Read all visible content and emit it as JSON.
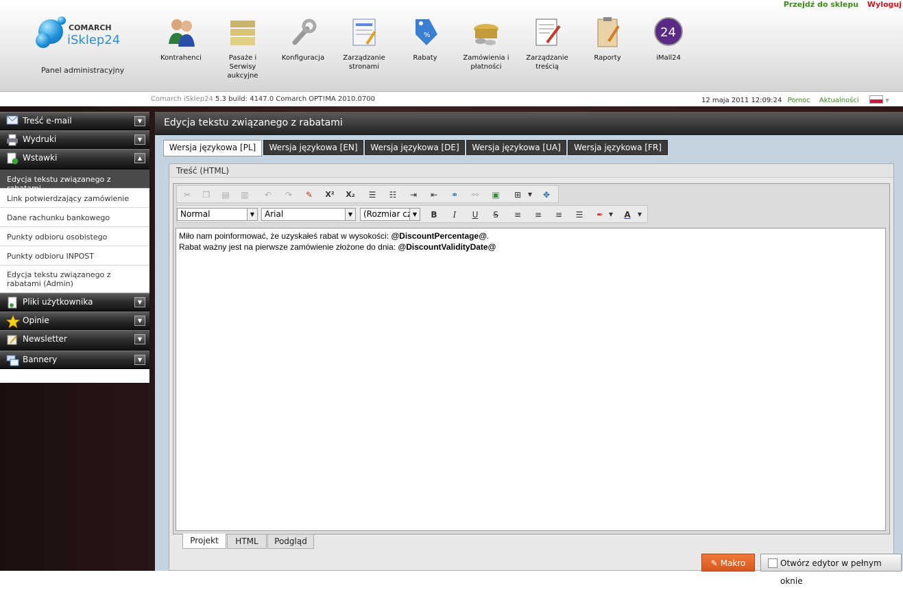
{
  "top_links": {
    "shop": "Przejdź do sklepu",
    "logout": "Wyloguj"
  },
  "logo": {
    "brand1": "COMARCH",
    "brand2": "iSklep24",
    "subtitle": "Panel administracyjny"
  },
  "nav": [
    {
      "label": "Kontrahenci",
      "icon": "users-icon"
    },
    {
      "label": "Pasaże i Serwisy aukcyjne",
      "icon": "folders-icon"
    },
    {
      "label": "Konfiguracja",
      "icon": "wrench-icon"
    },
    {
      "label": "Zarządzanie stronami",
      "icon": "pages-icon"
    },
    {
      "label": "Rabaty",
      "icon": "discount-tag-icon"
    },
    {
      "label": "Zamówienia i płatności",
      "icon": "coins-basket-icon"
    },
    {
      "label": "Zarządzanie treścią",
      "icon": "content-edit-icon"
    },
    {
      "label": "Raporty",
      "icon": "clipboard-icon"
    },
    {
      "label": "iMall24",
      "icon": "imall24-icon"
    }
  ],
  "info": {
    "version_prefix": "Comarch iSklep24",
    "version": "5.3 build: 4147.0  Comarch OPT!MA 2010.0700",
    "datetime": "12 maja 2011 12:09:24",
    "help": "Pomoc",
    "news": "Aktualności"
  },
  "sidebar": {
    "sec1": "Treść e-mail",
    "sec2": "Wydruki",
    "sec3": "Wstawki",
    "items": [
      "Edycja tekstu związanego z rabatami",
      "Link potwierdzający zamówienie",
      "Dane rachunku bankowego",
      "Punkty odbioru osobistego",
      "Punkty odbioru INPOST",
      "Edycja tekstu związanego z rabatami (Admin)"
    ],
    "sec4": "Pliki użytkownika",
    "sec5": "Opinie",
    "sec6": "Newsletter",
    "sec7": "Bannery"
  },
  "main": {
    "title": "Edycja tekstu związanego z rabatami",
    "tabs": [
      "Wersja językowa [PL]",
      "Wersja językowa [EN]",
      "Wersja językowa [DE]",
      "Wersja językowa [UA]",
      "Wersja językowa [FR]"
    ],
    "panel_title": "Treść (HTML)",
    "format": "Normal",
    "font": "Arial",
    "size": "(Rozmiar czcionki)",
    "line1": "Miło nam poinformować, że uzyskałeś rabat w wysokości: ",
    "line1_tag": "@DiscountPercentage@",
    "line1_end": ".",
    "line2": "Rabat ważny jest na pierwsze zamówienie złożone do dnia: ",
    "line2_tag": "@DiscountValidityDate@",
    "mode_tabs": [
      "Projekt",
      "HTML",
      "Podgląd"
    ],
    "btn_makro": "Makro",
    "btn_full": "Otwórz edytor w pełnym oknie"
  },
  "colors": {
    "accent": "#3d8a1e",
    "logout": "#c8141b",
    "makro": "#e8692a"
  }
}
